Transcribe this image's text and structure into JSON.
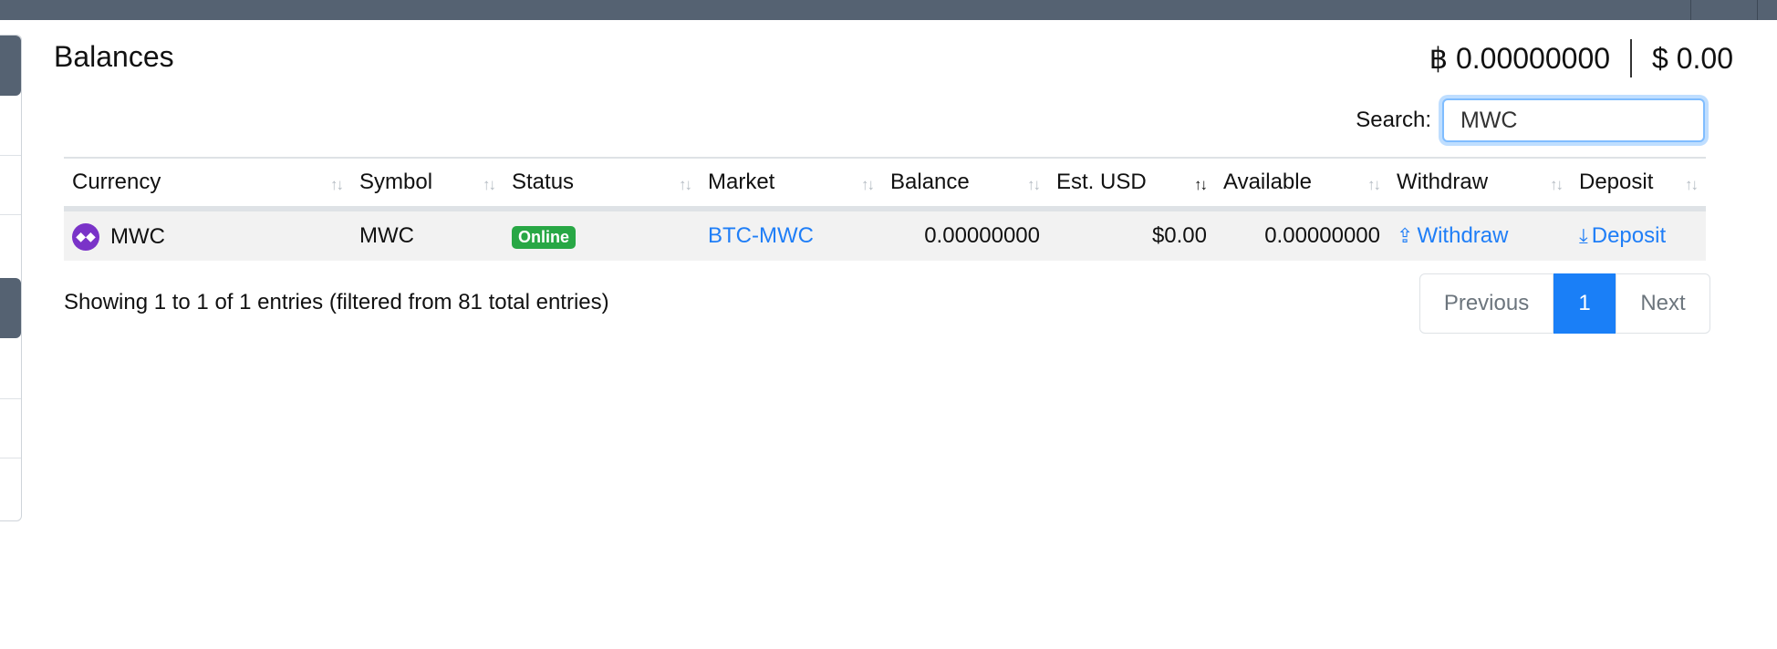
{
  "page": {
    "title": "Balances"
  },
  "totals": {
    "btc": "฿ 0.00000000",
    "usd": "$ 0.00"
  },
  "search": {
    "label": "Search:",
    "value": "MWC"
  },
  "table": {
    "headers": [
      "Currency",
      "Symbol",
      "Status",
      "Market",
      "Balance",
      "Est. USD",
      "Available",
      "Withdraw",
      "Deposit"
    ],
    "sort_icon": "↑↓",
    "rows": [
      {
        "currency": "MWC",
        "currency_icon": "mwc-coin-icon",
        "symbol": "MWC",
        "status": "Online",
        "market": "BTC-MWC",
        "balance": "0.00000000",
        "est_usd": "$0.00",
        "available": "0.00000000",
        "withdraw": "Withdraw",
        "deposit": "Deposit"
      }
    ]
  },
  "info": "Showing 1 to 1 of 1 entries (filtered from 81 total entries)",
  "pagination": {
    "previous": "Previous",
    "page": "1",
    "next": "Next"
  },
  "colors": {
    "accent": "#1f7ef7",
    "status_online": "#28a745",
    "topbar": "#556272",
    "coin": "#7a33c8"
  }
}
